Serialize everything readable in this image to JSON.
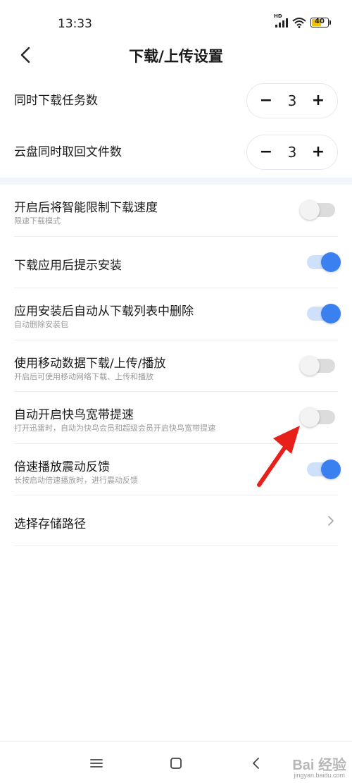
{
  "status_bar": {
    "time": "13:33",
    "network": "HD",
    "battery": "40"
  },
  "header": {
    "title": "下载/上传设置"
  },
  "steppers": [
    {
      "label": "同时下载任务数",
      "minus": "−",
      "value": "3",
      "plus": "+"
    },
    {
      "label": "云盘同时取回文件数",
      "minus": "−",
      "value": "3",
      "plus": "+"
    }
  ],
  "toggles": [
    {
      "title": "开启后将智能限制下载速度",
      "subtitle": "限速下载模式",
      "state": "off"
    },
    {
      "title": "下载应用后提示安装",
      "subtitle": "",
      "state": "on"
    },
    {
      "title": "应用安装后自动从下载列表中删除",
      "subtitle": "自动删除安装包",
      "state": "on"
    },
    {
      "title": "使用移动数据下载/上传/播放",
      "subtitle": "开启后可使用移动网络下载、上传和播放",
      "state": "off"
    },
    {
      "title": "自动开启快鸟宽带提速",
      "subtitle": "打开迅雷时，自动为快鸟会员和超级会员开启快鸟宽带提速",
      "state": "off"
    },
    {
      "title": "倍速播放震动反馈",
      "subtitle": "长按启动倍速播放时，进行震动反馈",
      "state": "on"
    }
  ],
  "storage": {
    "label": "选择存储路径"
  },
  "watermark": {
    "text": "Bai 经验",
    "sub": "jingyan.baidu.com"
  },
  "colors": {
    "accent": "#3a80f0",
    "toggle_on_track": "#cfe0fb",
    "toggle_off_track": "#dcdcdc",
    "section_bg": "#f2f6fb",
    "arrow": "#e8201c"
  }
}
